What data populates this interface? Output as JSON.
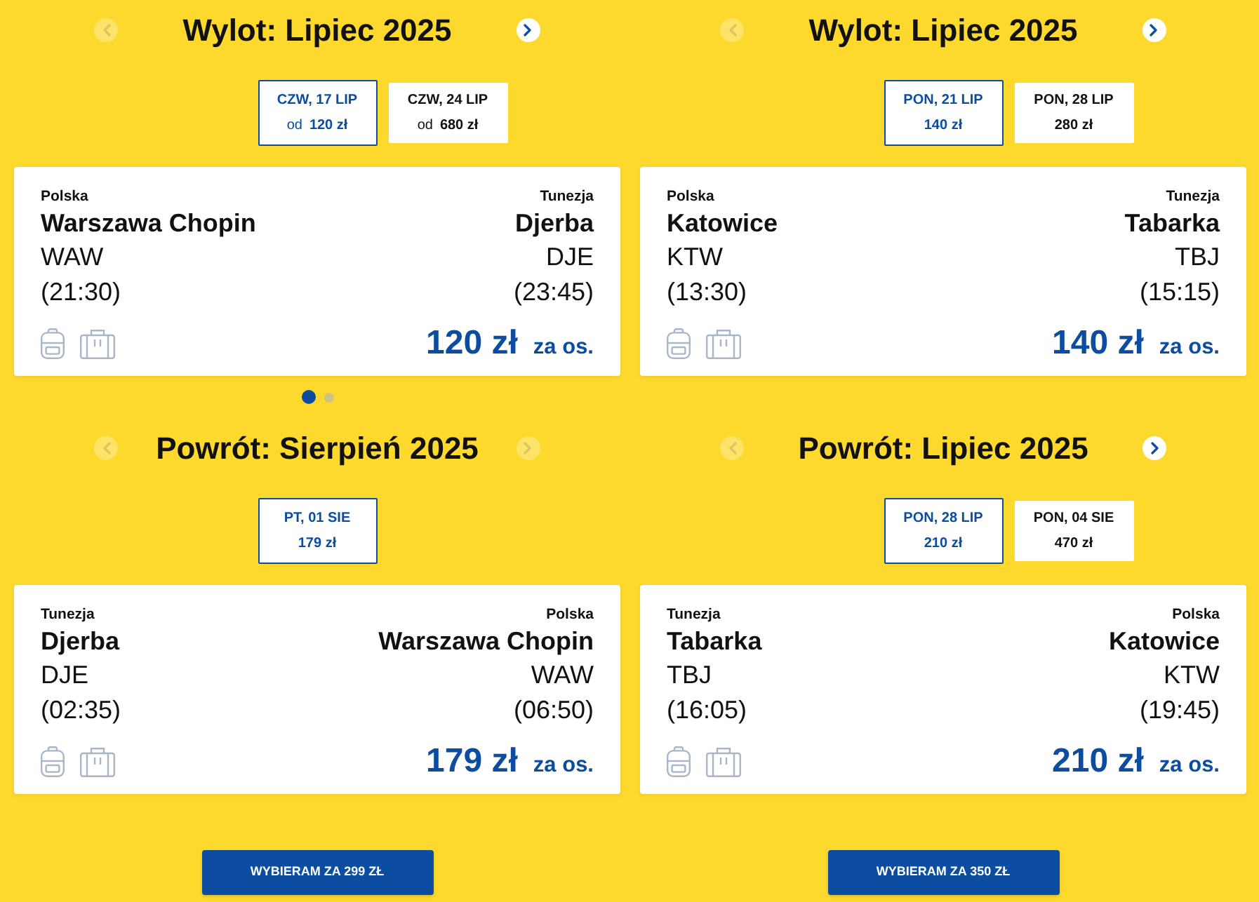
{
  "columns": [
    {
      "outbound": {
        "title": "Wylot: Lipiec 2025",
        "prev": {
          "disabled": true
        },
        "next": {
          "disabled": false
        },
        "dates": [
          {
            "day": "CZW, 17 LIP",
            "prefix": "od",
            "price": "120 zł",
            "selected": true
          },
          {
            "day": "CZW, 24 LIP",
            "prefix": "od",
            "price": "680 zł",
            "selected": false
          }
        ],
        "flight": {
          "origin": {
            "country": "Polska",
            "city": "Warszawa Chopin",
            "code": "WAW",
            "time": "(21:30)"
          },
          "destination": {
            "country": "Tunezja",
            "city": "Djerba",
            "code": "DJE",
            "time": "(23:45)"
          },
          "price": "120 zł",
          "per_person": "za os."
        },
        "pagination": [
          {
            "selected": true
          },
          {
            "selected": false
          }
        ]
      },
      "return": {
        "title": "Powrót: Sierpień 2025",
        "prev": {
          "disabled": true
        },
        "next": {
          "disabled": true
        },
        "dates": [
          {
            "day": "PT, 01 SIE",
            "price": "179 zł",
            "selected": true
          }
        ],
        "flight": {
          "origin": {
            "country": "Tunezja",
            "city": "Djerba",
            "code": "DJE",
            "time": "(02:35)"
          },
          "destination": {
            "country": "Polska",
            "city": "Warszawa Chopin",
            "code": "WAW",
            "time": "(06:50)"
          },
          "price": "179 zł",
          "per_person": "za os."
        }
      },
      "select_button": "WYBIERAM ZA 299 ZŁ"
    },
    {
      "outbound": {
        "title": "Wylot: Lipiec 2025",
        "prev": {
          "disabled": true
        },
        "next": {
          "disabled": false
        },
        "dates": [
          {
            "day": "PON, 21 LIP",
            "price": "140 zł",
            "selected": true
          },
          {
            "day": "PON, 28 LIP",
            "price": "280 zł",
            "selected": false
          }
        ],
        "flight": {
          "origin": {
            "country": "Polska",
            "city": "Katowice",
            "code": "KTW",
            "time": "(13:30)"
          },
          "destination": {
            "country": "Tunezja",
            "city": "Tabarka",
            "code": "TBJ",
            "time": "(15:15)"
          },
          "price": "140 zł",
          "per_person": "za os."
        }
      },
      "return": {
        "title": "Powrót: Lipiec 2025",
        "prev": {
          "disabled": true
        },
        "next": {
          "disabled": false
        },
        "dates": [
          {
            "day": "PON, 28 LIP",
            "price": "210 zł",
            "selected": true
          },
          {
            "day": "PON, 04 SIE",
            "price": "470 zł",
            "selected": false
          }
        ],
        "flight": {
          "origin": {
            "country": "Tunezja",
            "city": "Tabarka",
            "code": "TBJ",
            "time": "(16:05)"
          },
          "destination": {
            "country": "Polska",
            "city": "Katowice",
            "code": "KTW",
            "time": "(19:45)"
          },
          "price": "210 zł",
          "per_person": "za os."
        }
      },
      "select_button": "WYBIERAM ZA 350 ZŁ"
    }
  ]
}
